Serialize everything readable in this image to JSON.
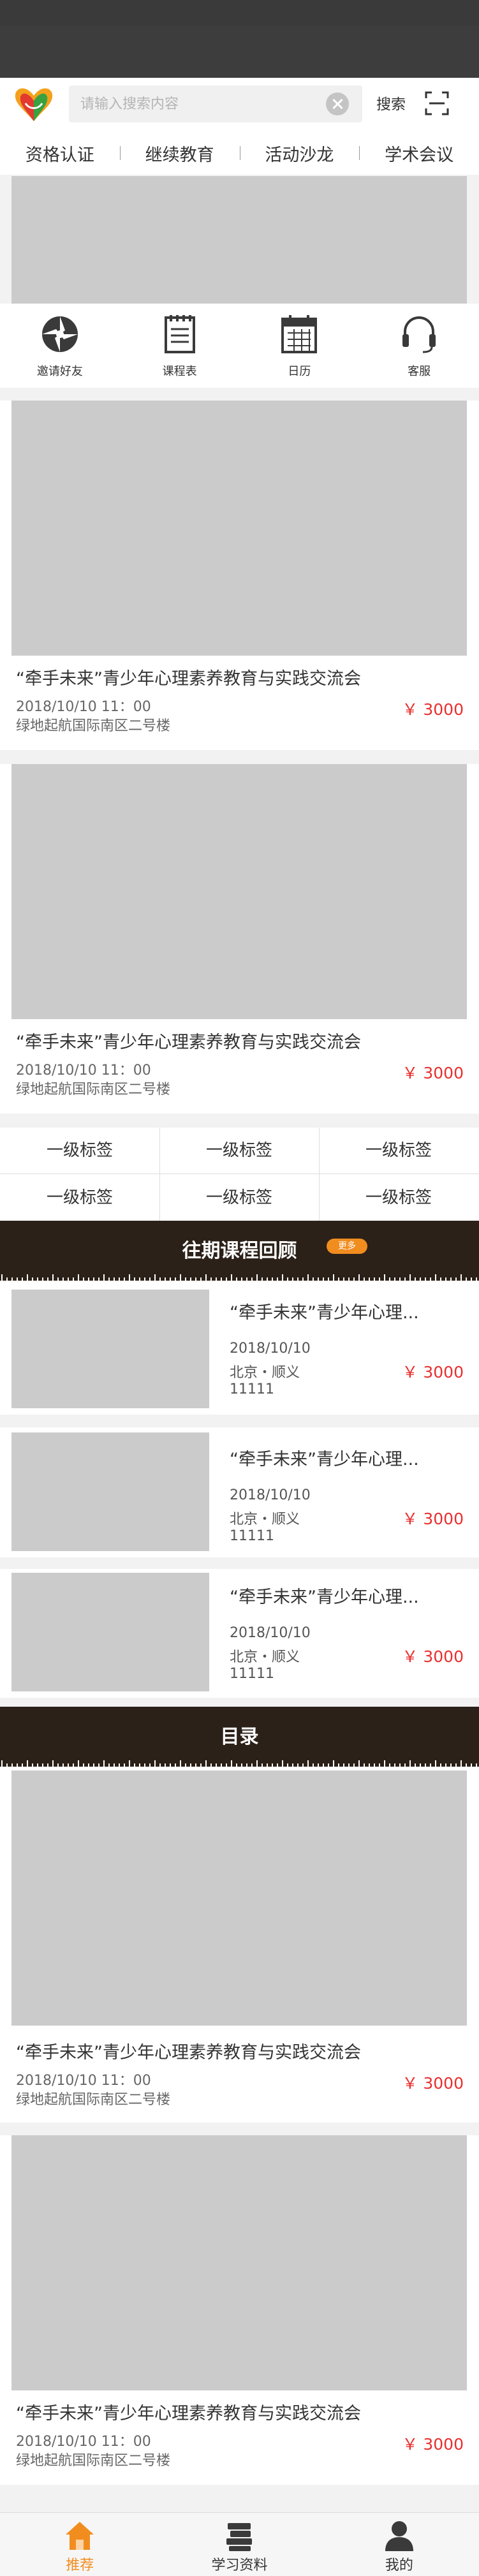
{
  "header": {
    "search_placeholder": "请输入搜索内容",
    "search_label": "搜索"
  },
  "nav_tabs": [
    "资格认证",
    "继续教育",
    "活动沙龙",
    "学术会议"
  ],
  "quick_menu": [
    {
      "label": "邀请好友",
      "icon": "aperture-icon"
    },
    {
      "label": "课程表",
      "icon": "notebook-icon"
    },
    {
      "label": "日历",
      "icon": "calendar-icon"
    },
    {
      "label": "客服",
      "icon": "headset-icon"
    }
  ],
  "events_top": [
    {
      "title": "“牵手未来”青少年心理素养教育与实践交流会",
      "time": "2018/10/10 11：00",
      "place": "绿地起航国际南区二号楼",
      "price": "￥ 3000"
    },
    {
      "title": "“牵手未来”青少年心理素养教育与实践交流会",
      "time": "2018/10/10 11：00",
      "place": "绿地起航国际南区二号楼",
      "price": "￥ 3000"
    }
  ],
  "tags": [
    "一级标签",
    "一级标签",
    "一级标签",
    "一级标签",
    "一级标签",
    "一级标签"
  ],
  "past_courses": {
    "title": "往期课程回顾",
    "more_label": "更多",
    "items": [
      {
        "title": "“牵手未来”青少年心理...",
        "date": "2018/10/10",
        "location": "北京・顺义",
        "number": "11111",
        "price": "￥ 3000"
      },
      {
        "title": "“牵手未来”青少年心理...",
        "date": "2018/10/10",
        "location": "北京・顺义",
        "number": "11111",
        "price": "￥ 3000"
      },
      {
        "title": "“牵手未来”青少年心理...",
        "date": "2018/10/10",
        "location": "北京・顺义",
        "number": "11111",
        "price": "￥ 3000"
      }
    ]
  },
  "catalog": {
    "title": "目录",
    "items": [
      {
        "title": "“牵手未来”青少年心理素养教育与实践交流会",
        "time": "2018/10/10 11：00",
        "place": "绿地起航国际南区二号楼",
        "price": "￥ 3000"
      },
      {
        "title": "“牵手未来”青少年心理素养教育与实践交流会",
        "time": "2018/10/10 11：00",
        "place": "绿地起航国际南区二号楼",
        "price": "￥ 3000"
      }
    ]
  },
  "bottom_nav": [
    {
      "label": "推荐",
      "icon": "home-icon",
      "active": true
    },
    {
      "label": "学习资料",
      "icon": "books-icon",
      "active": false
    },
    {
      "label": "我的",
      "icon": "user-icon",
      "active": false
    }
  ],
  "colors": {
    "accent": "#f18d1f",
    "price": "#e8302f",
    "section_bar": "#2b2119",
    "placeholder_image": "#cbcbcb"
  }
}
